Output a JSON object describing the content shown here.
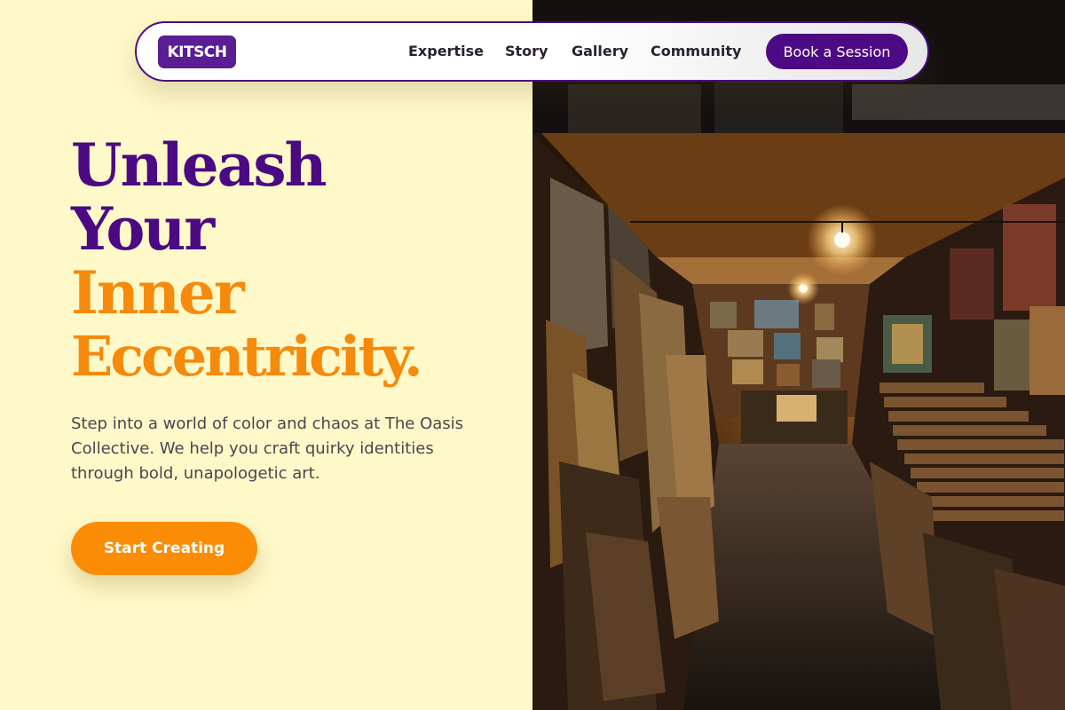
{
  "brand": {
    "logo_text": "KITSCH"
  },
  "nav": {
    "links": [
      "Expertise",
      "Story",
      "Gallery",
      "Community"
    ],
    "cta_label": "Book a Session"
  },
  "hero": {
    "headline": [
      "Unleash",
      "Your",
      "Inner",
      "Eccentricity."
    ],
    "subtext": "Step into a world of color and chaos at The Oasis Collective. We help you craft quirky identities through bold, unapologetic art.",
    "cta_label": "Start Creating"
  },
  "image": {
    "description_icon": "art-gallery-photo"
  },
  "colors": {
    "accent_purple": "#4b0a82",
    "accent_orange": "#f58a0c",
    "background_cream": "#fff9c9"
  }
}
